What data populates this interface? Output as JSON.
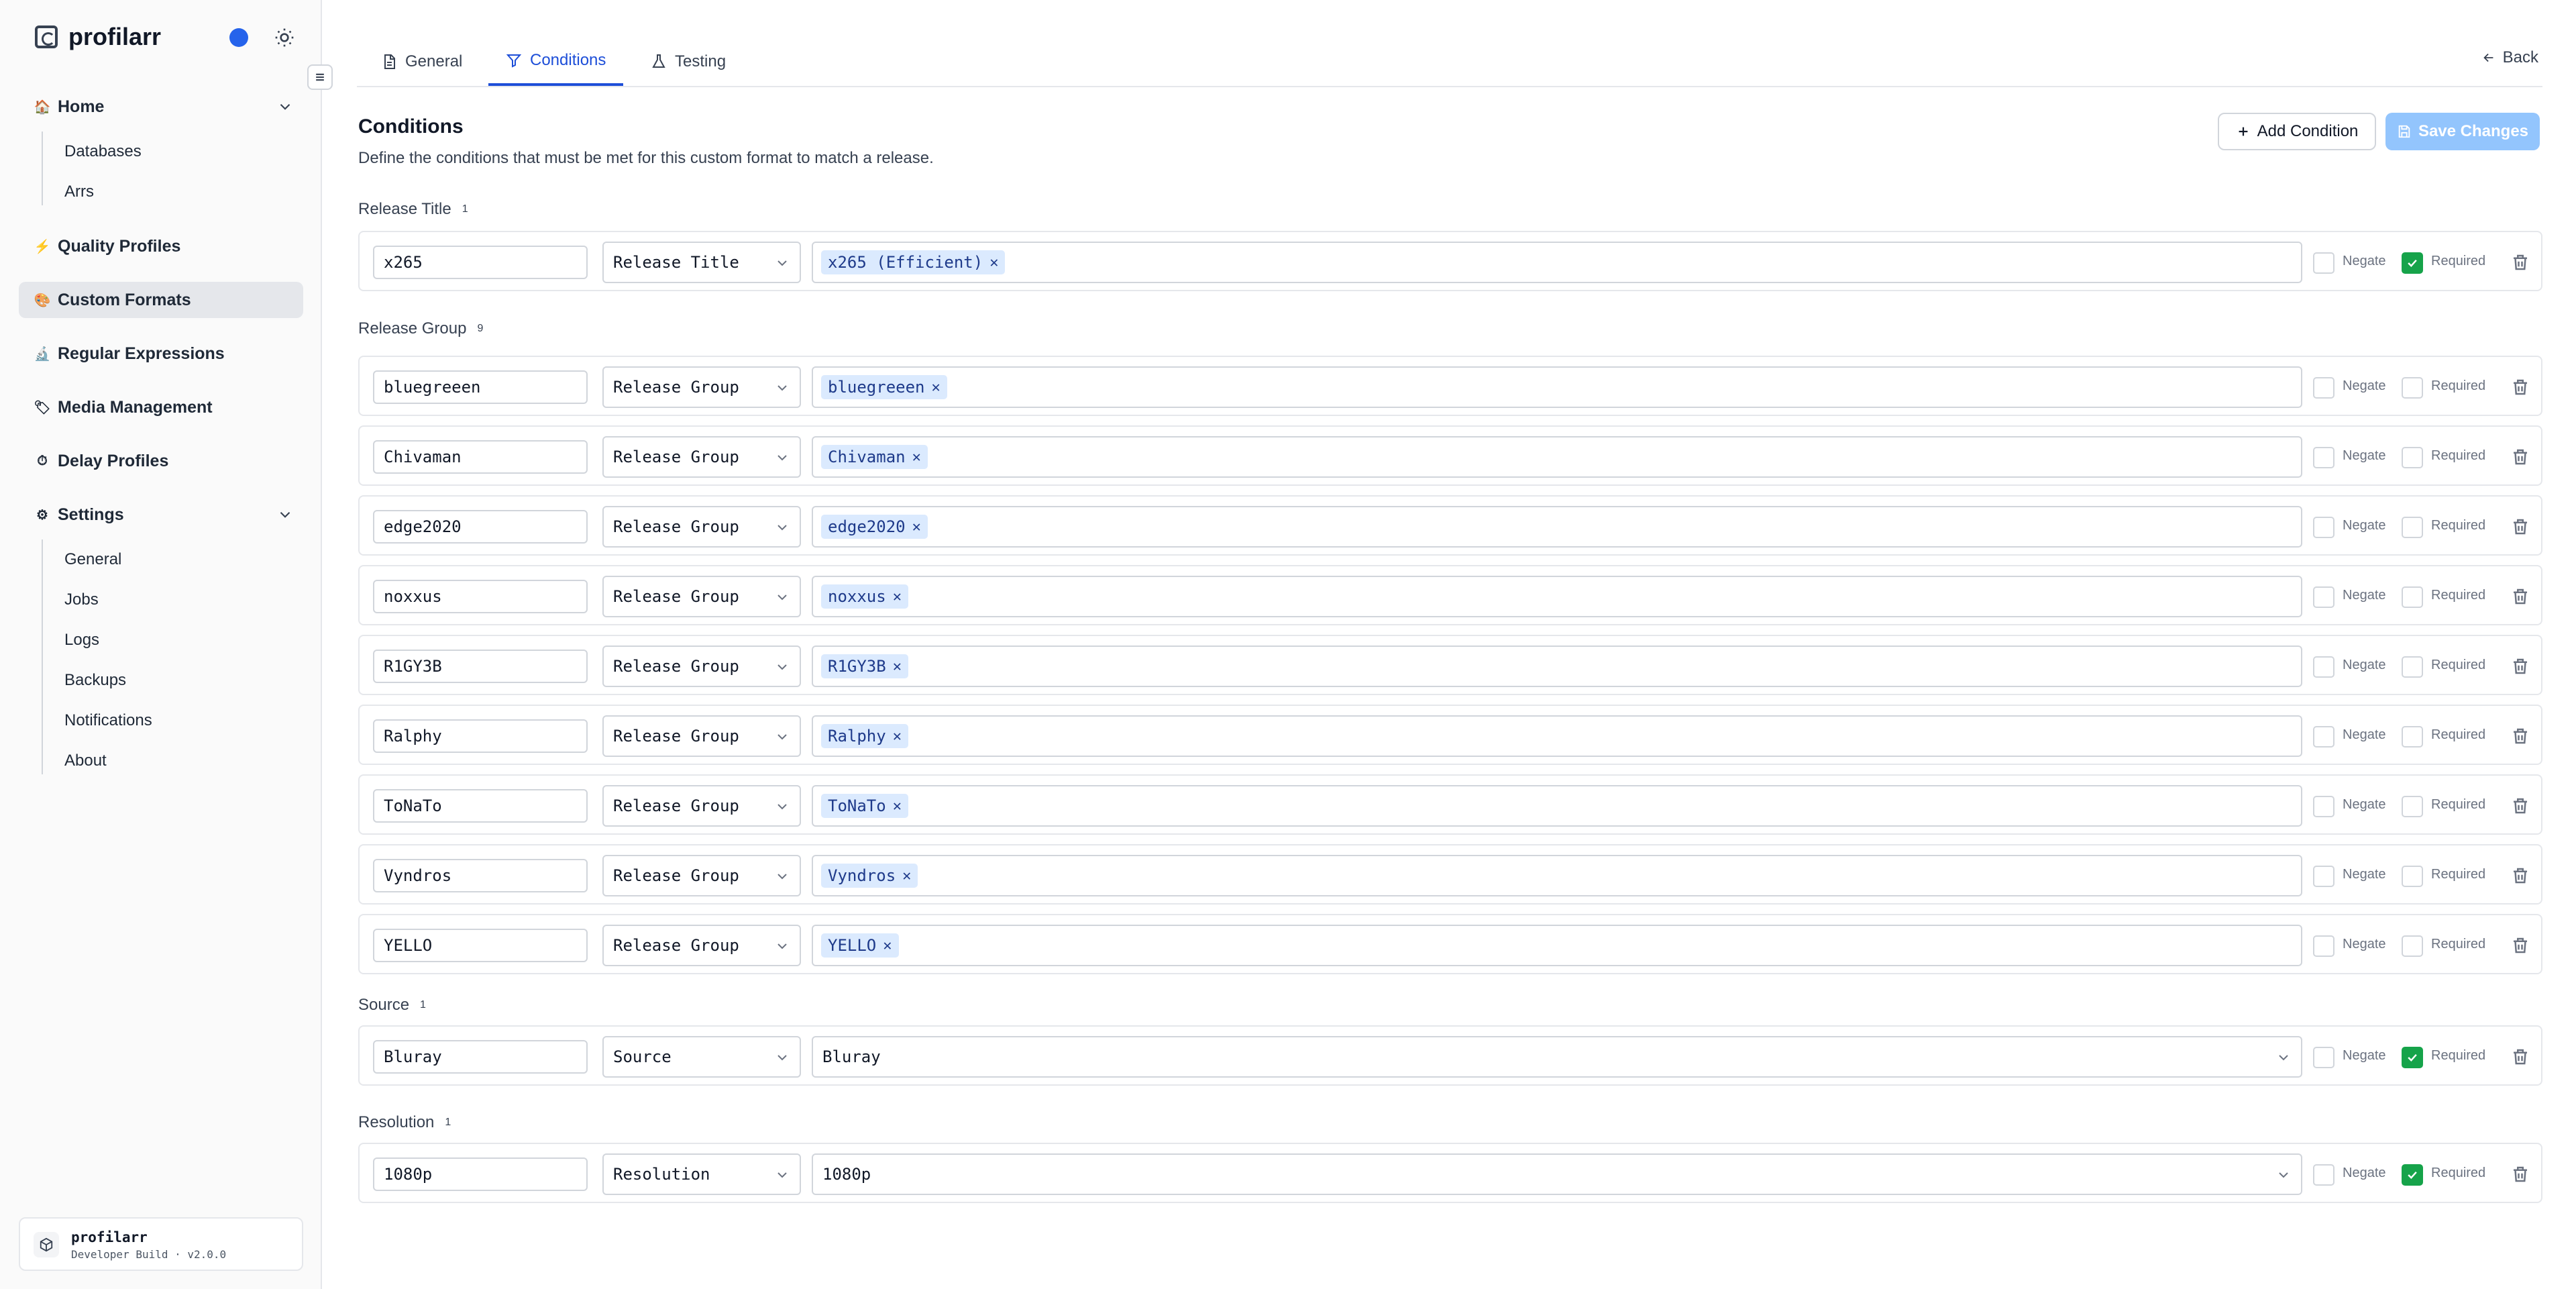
{
  "app": {
    "name": "profilarr"
  },
  "sidebar": {
    "items": [
      {
        "label": "Home",
        "icon": "home-icon"
      },
      {
        "label": "Quality Profiles",
        "icon": "bolt-icon"
      },
      {
        "label": "Custom Formats",
        "icon": "palette-icon"
      },
      {
        "label": "Regular Expressions",
        "icon": "flask-icon"
      },
      {
        "label": "Media Management",
        "icon": "tag-icon"
      },
      {
        "label": "Delay Profiles",
        "icon": "timer-icon"
      },
      {
        "label": "Settings",
        "icon": "gear-icon"
      }
    ],
    "home_sub": [
      "Databases",
      "Arrs"
    ],
    "settings_sub": [
      "General",
      "Jobs",
      "Logs",
      "Backups",
      "Notifications",
      "About"
    ],
    "footer": {
      "name": "profilarr",
      "version": "Developer Build · v2.0.0"
    }
  },
  "tabs": [
    {
      "label": "General"
    },
    {
      "label": "Conditions"
    },
    {
      "label": "Testing"
    }
  ],
  "back_label": "Back",
  "section": {
    "title": "Conditions",
    "description": "Define the conditions that must be met for this custom format to match a release."
  },
  "buttons": {
    "add": "Add Condition",
    "save": "Save Changes"
  },
  "labels": {
    "negate": "Negate",
    "required": "Required"
  },
  "groups": [
    {
      "title": "Release Title",
      "count": "1"
    },
    {
      "title": "Release Group",
      "count": "9"
    },
    {
      "title": "Source",
      "count": "1"
    },
    {
      "title": "Resolution",
      "count": "1"
    }
  ],
  "conditions": [
    {
      "name": "x265",
      "type": "Release Title",
      "value": "x265 (Efficient)",
      "required": true
    },
    {
      "name": "bluegreeen",
      "type": "Release Group",
      "value": "bluegreeen",
      "required": false
    },
    {
      "name": "Chivaman",
      "type": "Release Group",
      "value": "Chivaman",
      "required": false
    },
    {
      "name": "edge2020",
      "type": "Release Group",
      "value": "edge2020",
      "required": false
    },
    {
      "name": "noxxus",
      "type": "Release Group",
      "value": "noxxus",
      "required": false
    },
    {
      "name": "R1GY3B",
      "type": "Release Group",
      "value": "R1GY3B",
      "required": false
    },
    {
      "name": "Ralphy",
      "type": "Release Group",
      "value": "Ralphy",
      "required": false
    },
    {
      "name": "ToNaTo",
      "type": "Release Group",
      "value": "ToNaTo",
      "required": false
    },
    {
      "name": "Vyndros",
      "type": "Release Group",
      "value": "Vyndros",
      "required": false
    },
    {
      "name": "YELLO",
      "type": "Release Group",
      "value": "YELLO",
      "required": false
    },
    {
      "name": "Bluray",
      "type": "Source",
      "value": "Bluray",
      "required": true
    },
    {
      "name": "1080p",
      "type": "Resolution",
      "value": "1080p",
      "required": true
    }
  ],
  "colors": {
    "accent": "#1d4ed8",
    "chip_bg": "#dbeafe",
    "required_green": "#16a34a",
    "theme_dot": "#2563eb"
  }
}
